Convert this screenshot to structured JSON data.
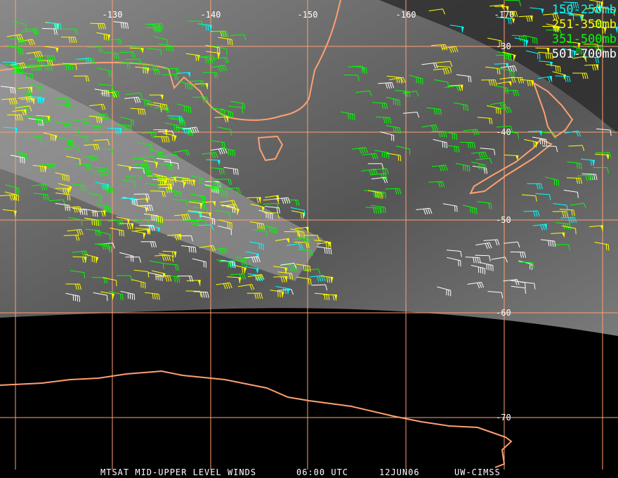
{
  "legend": [
    {
      "label": "150-250mb",
      "color": "#00ffff"
    },
    {
      "label": "251-350mb",
      "color": "#ffff00"
    },
    {
      "label": "351-500mb",
      "color": "#00ff00"
    },
    {
      "label": "501-700mb",
      "color": "#ffffff"
    }
  ],
  "longitude_labels": [
    "-130",
    "-140",
    "-150",
    "-160",
    "-170"
  ],
  "latitude_labels": [
    "-30",
    "-40",
    "-50",
    "-60",
    "-70"
  ],
  "footer": {
    "product": "MTSAT MID-UPPER LEVEL WINDS",
    "time": "06:00 UTC",
    "date": "12JUN06",
    "source": "UW-CIMSS"
  },
  "colors": {
    "grid": "#ffa070",
    "coast": "#ffa070",
    "background": "#000000"
  }
}
